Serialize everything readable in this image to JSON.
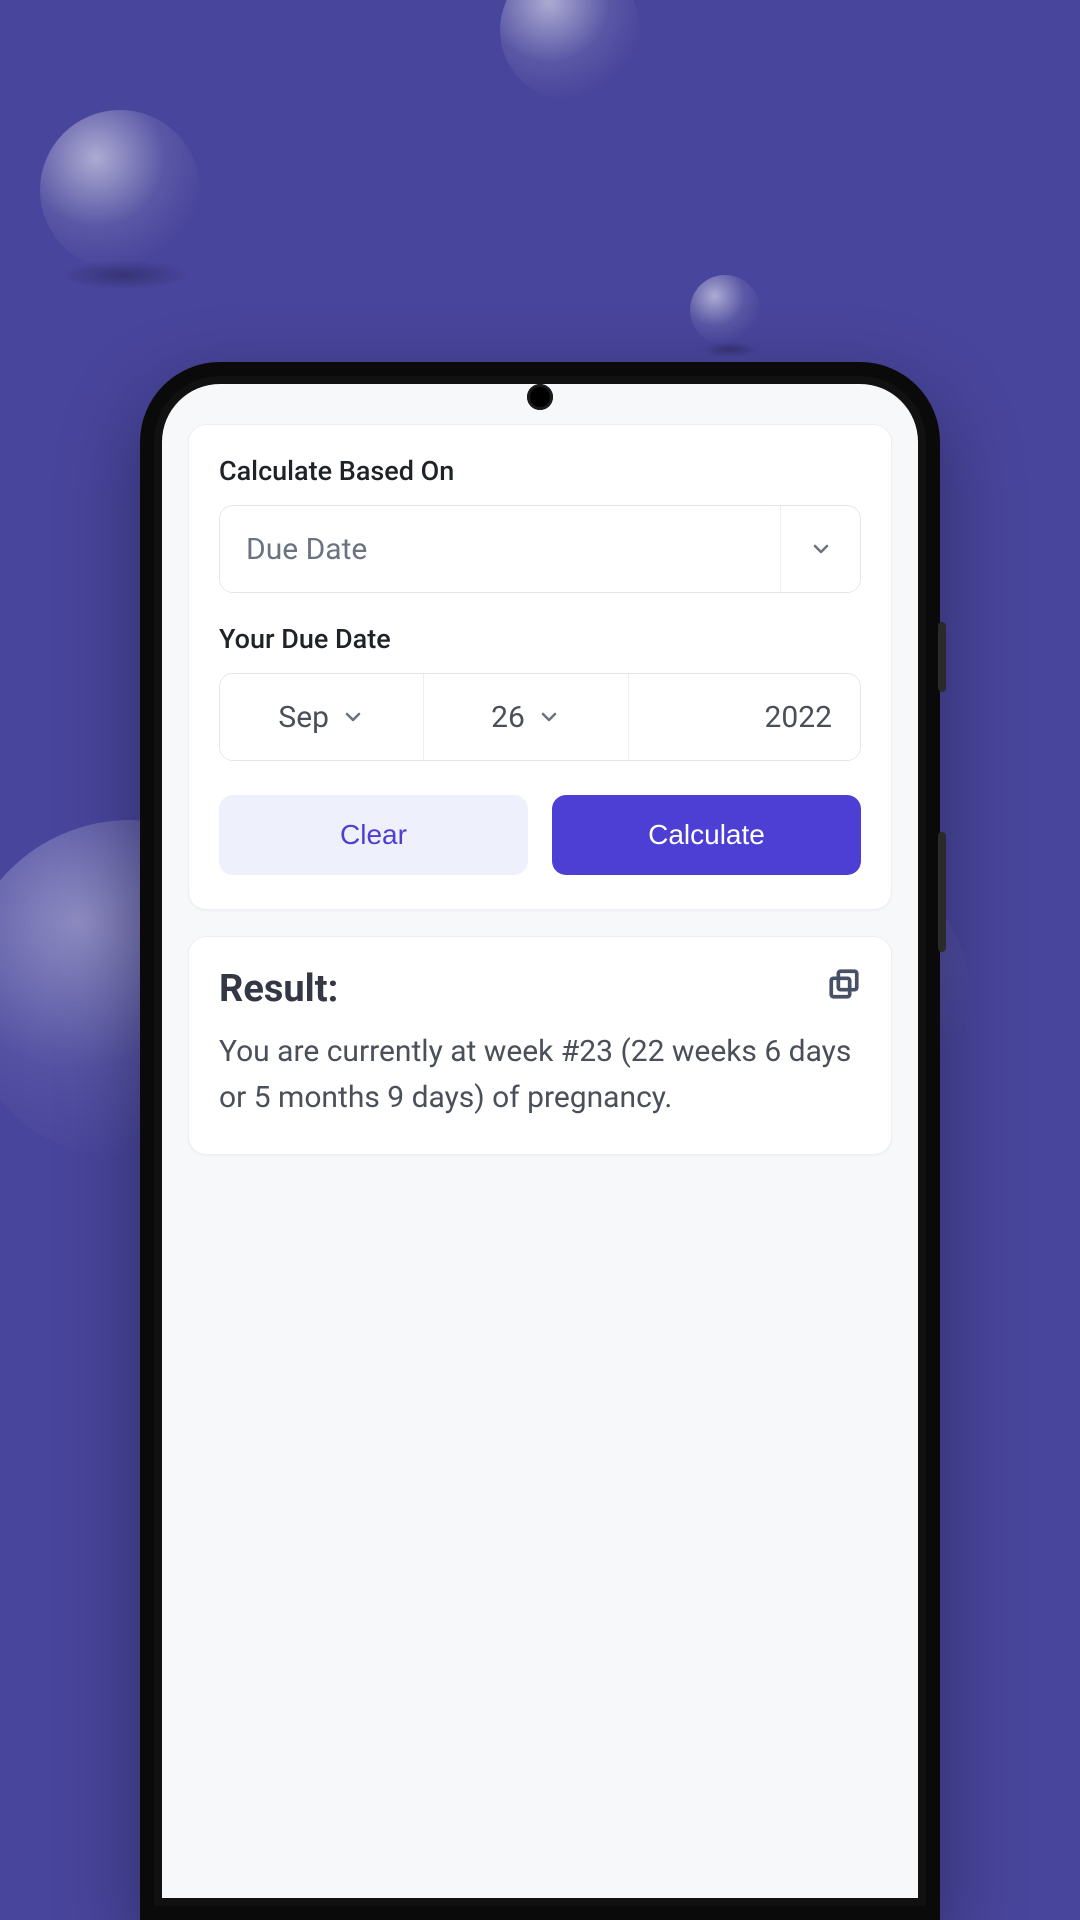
{
  "form": {
    "basis_label": "Calculate Based On",
    "basis_value": "Due Date",
    "date_label": "Your Due Date",
    "date": {
      "month": "Sep",
      "day": "26",
      "year": "2022"
    },
    "clear_label": "Clear",
    "calculate_label": "Calculate"
  },
  "result": {
    "title": "Result:",
    "text": "You are currently at week #23 (22 weeks 6 days or 5 months 9 days) of pregnancy."
  },
  "colors": {
    "accent": "#4d3fd4",
    "background": "#48459c"
  }
}
